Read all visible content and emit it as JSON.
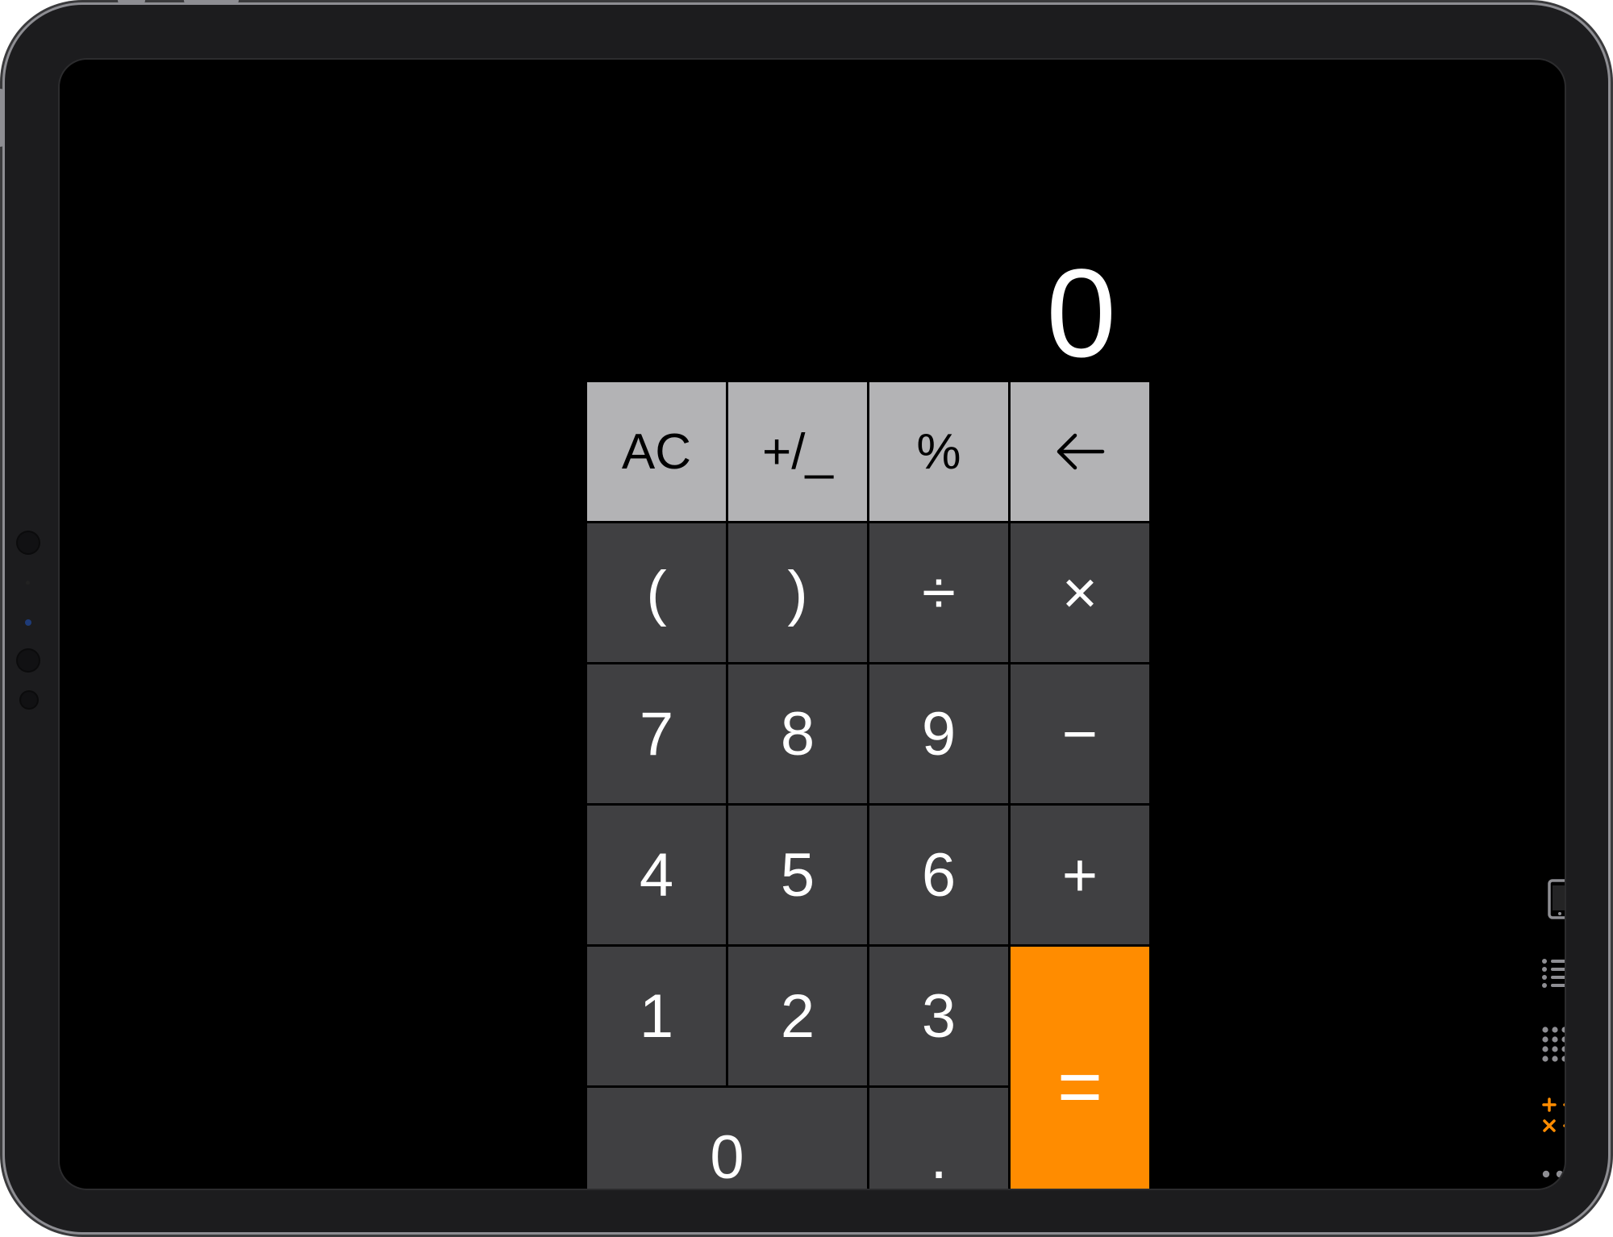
{
  "colors": {
    "device": "#1c1c1e",
    "screen": "#000000",
    "function_key": "#b3b3b5",
    "number_key": "#404042",
    "equals_key": "#ff8c00",
    "toolbar_icon": "#8e8e93",
    "toolbar_active": "#ff8c00"
  },
  "display": {
    "value": "0"
  },
  "keys": {
    "clear": "AC",
    "sign": "+/_",
    "percent": "%",
    "open_paren": "(",
    "close_paren": ")",
    "divide": "÷",
    "multiply": "×",
    "seven": "7",
    "eight": "8",
    "nine": "9",
    "minus": "−",
    "four": "4",
    "five": "5",
    "six": "6",
    "plus": "+",
    "one": "1",
    "two": "2",
    "three": "3",
    "equals": "=",
    "zero": "0",
    "decimal": "."
  },
  "icons": {
    "backspace": "backspace-arrow-icon",
    "toolbar": [
      "device-icon",
      "list-icon",
      "keypad-grid-icon",
      "calculator-operators-icon",
      "more-icon"
    ]
  }
}
